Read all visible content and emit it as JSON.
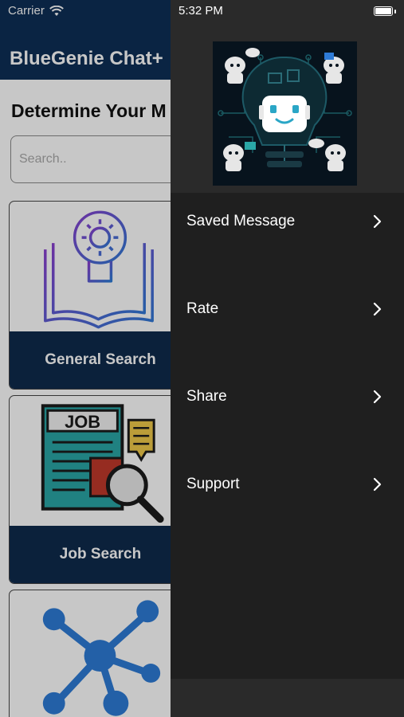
{
  "status_bar": {
    "carrier": "Carrier",
    "time": "5:32 PM"
  },
  "nav": {
    "title": "BlueGenie Chat+"
  },
  "main": {
    "section_title": "Determine Your M",
    "search": {
      "placeholder": "Search..",
      "value": ""
    },
    "cards": [
      {
        "label": "General Search",
        "icon": "lightbulb-book-icon"
      },
      {
        "label": "Job Search",
        "icon": "job-magnifier-icon"
      },
      {
        "label": "",
        "icon": "network-nodes-icon"
      }
    ]
  },
  "menu": {
    "logo_icon": "robot-lightbulb-logo",
    "items": [
      {
        "label": "Saved Message"
      },
      {
        "label": "Rate"
      },
      {
        "label": "Share"
      },
      {
        "label": "Support"
      }
    ]
  },
  "colors": {
    "nav_background": "#0e2f56",
    "card_label_background": "#0f2b4c",
    "menu_background": "#1f1f1f",
    "menu_header_background": "#2a2a2a",
    "accent_purple": "#7b3fc4",
    "accent_blue": "#2e7bd6",
    "teal": "#2aa6a6"
  }
}
